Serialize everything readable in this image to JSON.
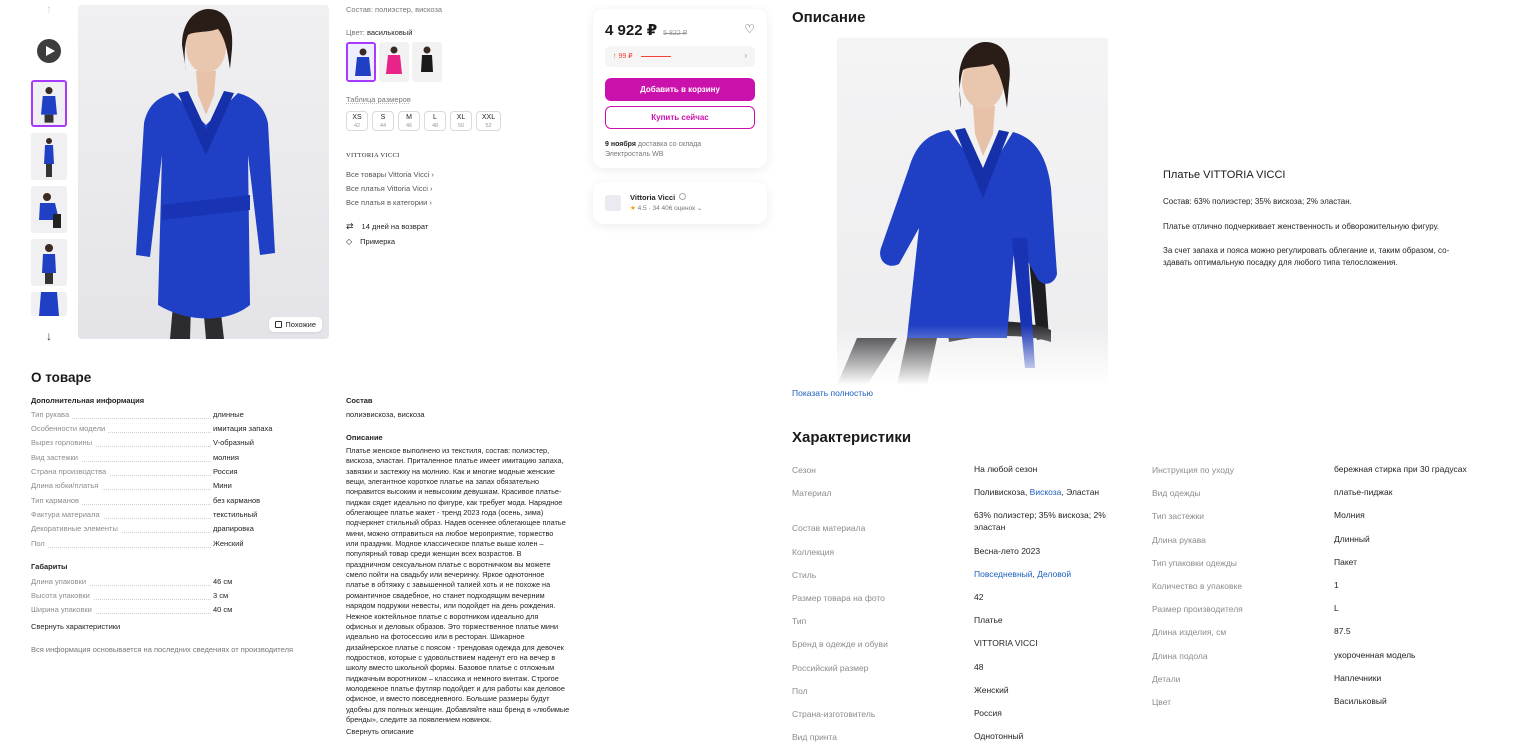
{
  "gallery": {
    "up_arrow": "↑",
    "down_arrow": "↓",
    "similar_label": "Похожие"
  },
  "product": {
    "composition_line": "Состав: полиэстер, вискоза",
    "color_label": "Цвет:",
    "color_value": "васильковый",
    "size_table_label": "Таблица размеров",
    "sizes": [
      {
        "label": "XS",
        "num": "42"
      },
      {
        "label": "S",
        "num": "44"
      },
      {
        "label": "M",
        "num": "46"
      },
      {
        "label": "L",
        "num": "48"
      },
      {
        "label": "XL",
        "num": "50"
      },
      {
        "label": "XXL",
        "num": "52"
      }
    ],
    "brand_logo": "VITTORIA VICCI",
    "links": [
      "Все товары Vittoria Vicci ›",
      "Все платья Vittoria Vicci ›",
      "Все платья в категории ›"
    ],
    "return_text": "14 дней на возврат",
    "fitting_text": "Примерка"
  },
  "price": {
    "current": "4 922 ₽",
    "old": "5 822 ₽",
    "wallet_discount": "↑ 99 ₽",
    "add_to_cart": "Добавить в корзину",
    "buy_now": "Купить сейчас",
    "delivery_date": "9 ноября",
    "delivery_rest": " доставка со склада",
    "delivery_warehouse": "Электросталь WB"
  },
  "seller": {
    "name": "Vittoria Vicci",
    "rating": "4.5",
    "reviews": "· 34 406 оценок ⌄"
  },
  "about": {
    "title": "О товаре",
    "additional_title": "Дополнительная информация",
    "additional": [
      {
        "k": "Тип рукава",
        "v": "длинные"
      },
      {
        "k": "Особенности модели",
        "v": "имитация запаха"
      },
      {
        "k": "Вырез горловины",
        "v": "V-образный"
      },
      {
        "k": "Вид застежки",
        "v": "молния"
      },
      {
        "k": "Страна производства",
        "v": "Россия"
      },
      {
        "k": "Длина юбки/платья",
        "v": "Мини"
      },
      {
        "k": "Тип карманов",
        "v": "без карманов"
      },
      {
        "k": "Фактура материала",
        "v": "текстильный"
      },
      {
        "k": "Декоративные элементы",
        "v": "драпировка"
      },
      {
        "k": "Пол",
        "v": "Женский"
      }
    ],
    "dimensions_title": "Габариты",
    "dimensions": [
      {
        "k": "Длина упаковки",
        "v": "46 см"
      },
      {
        "k": "Высота упаковки",
        "v": "3 см"
      },
      {
        "k": "Ширина упаковки",
        "v": "40 см"
      }
    ],
    "collapse_link": "Свернуть характеристики",
    "disclaimer": "Вся информация основывается на последних сведениях от производителя",
    "composition_title": "Состав",
    "composition_value": "полиэвискоза, вискоза",
    "description_title": "Описание",
    "description_lines": [
      "Платье женское выполнено из текстиля, состав: полиэстер,",
      "вискоза, эластан. Приталенное платье имеет имитацию запаха,",
      "завязки и застежку на молнию. Как и многие модные женские",
      "вещи, элегантное короткое платье на запах обязательно",
      "понравится высоким и невысоким девушкам. Красивое платье-",
      "пиджак сядет идеально по фигуре, как требует мода. Нарядное",
      "облегающее платье жакет - тренд 2023 года (осень, зима)",
      "подчеркнет стильный образ. Надев осеннее облегающее платье",
      "мини, можно отправиться на любое мероприятие, торжество",
      "или праздник. Модное классическое платье выше колен –",
      "популярный товар среди женщин всех возрастов. В",
      "праздничном сексуальном платье с воротничком вы можете",
      "смело пойти на свадьбу или вечеринку. Яркое однотонное",
      "платье в обтяжку с завышенной талией хоть и не похоже на",
      "романтичное свадебное, но станет подходящим вечерним",
      "нарядом подружки невесты, или подойдет на день рождения.",
      "Нежное коктейльное платье с воротником идеально для",
      "офисных и деловых образов. Это торжественное платье мини",
      "идеально на фотосессию или в ресторан. Шикарное",
      "дизайнерское платье с поясом - трендовая одежда для девочек",
      "подростков, которые с удовольствием наденут его на вечер в",
      "школу вместо школьной формы. Базовое платье с отложным",
      "пиджачным воротником – классика и немного винтаж. Строгое",
      "молодежное платье футляр подойдет и для работы как деловое",
      "офисное, и вместо повседневного. Большие размеры будут",
      "удобны для полных женщин. Добавляйте наш бренд в «любимые",
      "бренды», следите за появлением новинок."
    ],
    "collapse_description": "Свернуть описание"
  },
  "rich_description": {
    "title": "Описание",
    "heading": "Платье VITTORIA VICCI",
    "p1": "Состав: 63% полиэстер; 35% вискоза; 2% эластан.",
    "p2": "Платье отлично подчеркивает женственность и обворожительную фигуру.",
    "p3_line1": "За счет запаха и пояса можно регулировать облегание и, таким образом, со-",
    "p3_line2": "здавать оптимальную посадку для любого типа телосложения.",
    "show_full": "Показать полностью"
  },
  "characteristics": {
    "title": "Характеристики",
    "left": [
      {
        "k": "Сезон",
        "v": "На любой сезон"
      },
      {
        "k": "Материал",
        "v_parts": [
          "Поливискоза, ",
          "Вискоза",
          ", Эластан"
        ]
      },
      {
        "k": "Состав материала",
        "v1": "63% полиэстер; 35% вискоза; 2%",
        "v2": "эластан"
      },
      {
        "k": "Коллекция",
        "v": "Весна-лето 2023"
      },
      {
        "k": "Стиль",
        "v_parts": [
          "Повседневный",
          ", ",
          "Деловой"
        ]
      },
      {
        "k": "Размер товара на фото",
        "v": "42"
      },
      {
        "k": "Тип",
        "v": "Платье"
      },
      {
        "k": "Бренд в одежде и обуви",
        "v": "VITTORIA VICCI"
      },
      {
        "k": "Российский размер",
        "v": "48"
      },
      {
        "k": "Пол",
        "v": "Женский"
      },
      {
        "k": "Страна-изготовитель",
        "v": "Россия"
      },
      {
        "k": "Вид принта",
        "v": "Однотонный"
      }
    ],
    "right": [
      {
        "k": "Инструкция по уходу",
        "v": "бережная стирка при 30 градусах"
      },
      {
        "k": "Вид одежды",
        "v": "платье-пиджак"
      },
      {
        "k": "Тип застежки",
        "v": "Молния"
      },
      {
        "k": "Длина рукава",
        "v": "Длинный"
      },
      {
        "k": "Тип упаковки одежды",
        "v": "Пакет"
      },
      {
        "k": "Количество в упаковке",
        "v": "1"
      },
      {
        "k": "Размер производителя",
        "v": "L"
      },
      {
        "k": "Длина изделия, см",
        "v": "87.5"
      },
      {
        "k": "Длина подола",
        "v": "укороченная модель"
      },
      {
        "k": "Детали",
        "v": "Наплечники"
      },
      {
        "k": "Цвет",
        "v": "Васильковый"
      }
    ]
  },
  "colors": {
    "accent": "#cb11ab",
    "selection": "#a73afd",
    "link": "#1c5fbf",
    "dress_blue": "#1f3fc4",
    "price_red": "#f44336"
  }
}
